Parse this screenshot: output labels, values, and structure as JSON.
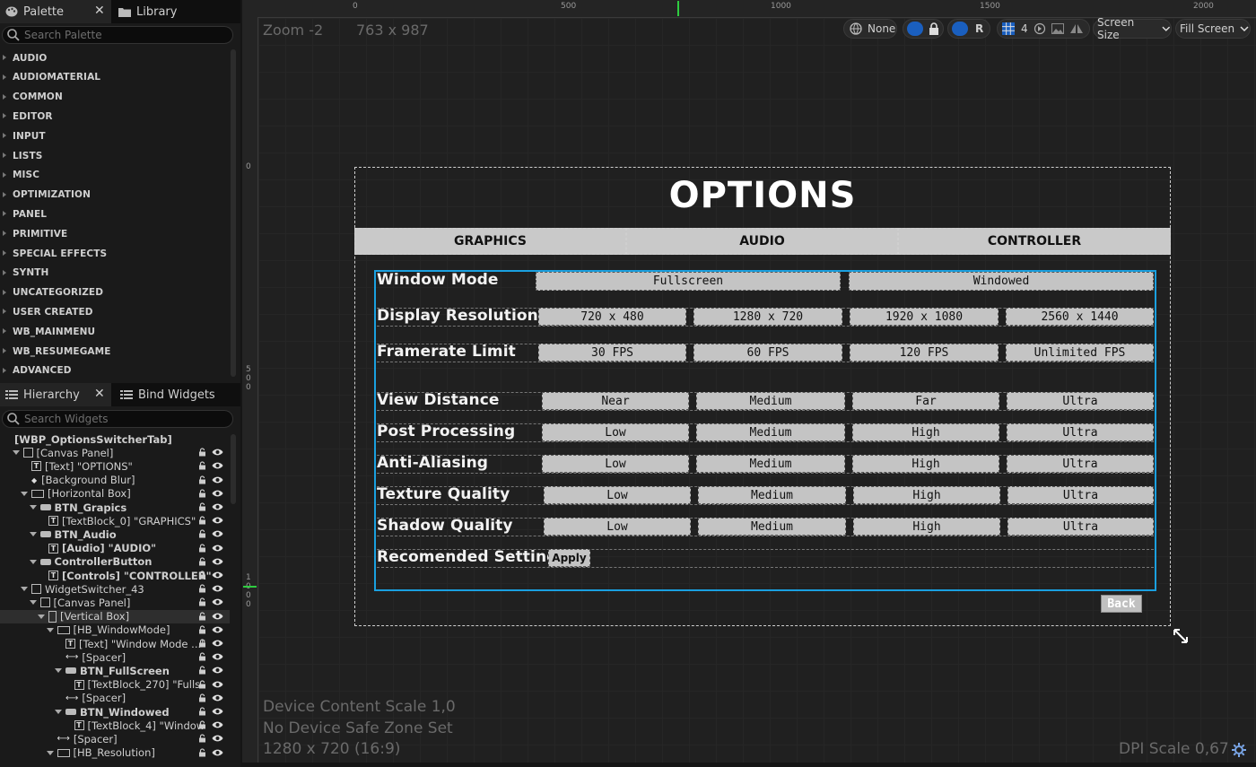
{
  "palette": {
    "tab_label": "Palette",
    "library_tab_label": "Library",
    "search_placeholder": "Search Palette",
    "categories": [
      "AUDIO",
      "AUDIOMATERIAL",
      "COMMON",
      "EDITOR",
      "INPUT",
      "LISTS",
      "MISC",
      "OPTIMIZATION",
      "PANEL",
      "PRIMITIVE",
      "SPECIAL EFFECTS",
      "SYNTH",
      "UNCATEGORIZED",
      "USER CREATED",
      "WB_MAINMENU",
      "WB_RESUMEGAME",
      "ADVANCED"
    ]
  },
  "hierarchy": {
    "tab_label": "Hierarchy",
    "bind_tab_label": "Bind Widgets",
    "search_placeholder": "Search Widgets",
    "items": [
      {
        "label": "[WBP_OptionsSwitcherTab]",
        "indent": 0,
        "arrow": false,
        "icon": "none",
        "bold": true
      },
      {
        "label": "[Canvas Panel]",
        "indent": 1,
        "arrow": true,
        "icon": "panel"
      },
      {
        "label": "[Text] \"OPTIONS\"",
        "indent": 2,
        "arrow": false,
        "icon": "text"
      },
      {
        "label": "[Background Blur]",
        "indent": 2,
        "arrow": false,
        "icon": "dot"
      },
      {
        "label": "[Horizontal Box]",
        "indent": 2,
        "arrow": true,
        "icon": "hbox"
      },
      {
        "label": "BTN_Grapics",
        "indent": 3,
        "arrow": true,
        "icon": "button",
        "bold": true
      },
      {
        "label": "[TextBlock_0] \"GRAPHICS\"",
        "indent": 4,
        "arrow": false,
        "icon": "text"
      },
      {
        "label": "BTN_Audio",
        "indent": 3,
        "arrow": true,
        "icon": "button",
        "bold": true
      },
      {
        "label": "[Audio] \"AUDIO\"",
        "indent": 4,
        "arrow": false,
        "icon": "text",
        "bold": true
      },
      {
        "label": "ControllerButton",
        "indent": 3,
        "arrow": true,
        "icon": "button",
        "bold": true
      },
      {
        "label": "[Controls] \"CONTROLLER\"",
        "indent": 4,
        "arrow": false,
        "icon": "text",
        "bold": true
      },
      {
        "label": "WidgetSwitcher_43",
        "indent": 2,
        "arrow": true,
        "icon": "switcher"
      },
      {
        "label": "[Canvas Panel]",
        "indent": 3,
        "arrow": true,
        "icon": "panel"
      },
      {
        "label": "[Vertical Box]",
        "indent": 4,
        "arrow": true,
        "icon": "vbox",
        "selected": true
      },
      {
        "label": "[HB_WindowMode]",
        "indent": 5,
        "arrow": true,
        "icon": "hbox"
      },
      {
        "label": "[Text] \"Window Mode ...\"",
        "indent": 6,
        "arrow": false,
        "icon": "text"
      },
      {
        "label": "[Spacer]",
        "indent": 6,
        "arrow": false,
        "icon": "spacer"
      },
      {
        "label": "BTN_FullScreen",
        "indent": 6,
        "arrow": true,
        "icon": "button",
        "bold": true
      },
      {
        "label": "[TextBlock_270] \"Fulls",
        "indent": 7,
        "arrow": false,
        "icon": "text"
      },
      {
        "label": "[Spacer]",
        "indent": 6,
        "arrow": false,
        "icon": "spacer"
      },
      {
        "label": "BTN_Windowed",
        "indent": 6,
        "arrow": true,
        "icon": "button",
        "bold": true
      },
      {
        "label": "[TextBlock_4] \"Window",
        "indent": 7,
        "arrow": false,
        "icon": "text"
      },
      {
        "label": "[Spacer]",
        "indent": 5,
        "arrow": false,
        "icon": "spacer"
      },
      {
        "label": "[HB_Resolution]",
        "indent": 5,
        "arrow": true,
        "icon": "hbox"
      }
    ]
  },
  "designer": {
    "zoom_label": "Zoom -2",
    "size_label": "763 x 987",
    "ruler_top": [
      "0",
      "500",
      "1000",
      "1500",
      "2000"
    ],
    "ruler_left": [
      "0",
      "500",
      "1000"
    ],
    "toolbar": {
      "none_label": "None",
      "r_label": "R",
      "grid_value": "4",
      "screen_size_label": "Screen Size",
      "fill_screen_label": "Fill Screen"
    },
    "device_scale": "Device Content Scale 1,0",
    "safe_zone": "No Device Safe Zone Set",
    "resolution": "1280 x 720 (16:9)",
    "dpi_scale": "DPI Scale 0,67"
  },
  "widget": {
    "title": "OPTIONS",
    "tabs": [
      "GRAPHICS",
      "AUDIO",
      "CONTROLLER"
    ],
    "window_mode": {
      "label": "Window Mode",
      "options": [
        "Fullscreen",
        "Windowed"
      ]
    },
    "rows": [
      {
        "label": "Display Resolution",
        "options": [
          "720 x 480",
          "1280 x 720",
          "1920 x 1080",
          "2560 x 1440"
        ]
      },
      {
        "label": "Framerate Limit",
        "options": [
          "30 FPS",
          "60 FPS",
          "120 FPS",
          "Unlimited FPS"
        ]
      },
      {
        "label": "View Distance",
        "options": [
          "Near",
          "Medium",
          "Far",
          "Ultra"
        ]
      },
      {
        "label": "Post Processing",
        "options": [
          "Low",
          "Medium",
          "High",
          "Ultra"
        ]
      },
      {
        "label": "Anti-Aliasing",
        "options": [
          "Low",
          "Medium",
          "High",
          "Ultra"
        ]
      },
      {
        "label": "Texture Quality",
        "options": [
          "Low",
          "Medium",
          "High",
          "Ultra"
        ]
      },
      {
        "label": "Shadow Quality",
        "options": [
          "Low",
          "Medium",
          "High",
          "Ultra"
        ]
      }
    ],
    "recommended": {
      "label": "Recomended Settings",
      "button": "Apply"
    },
    "back_label": "Back",
    "colors": {
      "selection": "#1aa0e0",
      "button_bg": "#c4c4c4",
      "tab_bg": "#c9c9c9"
    }
  }
}
